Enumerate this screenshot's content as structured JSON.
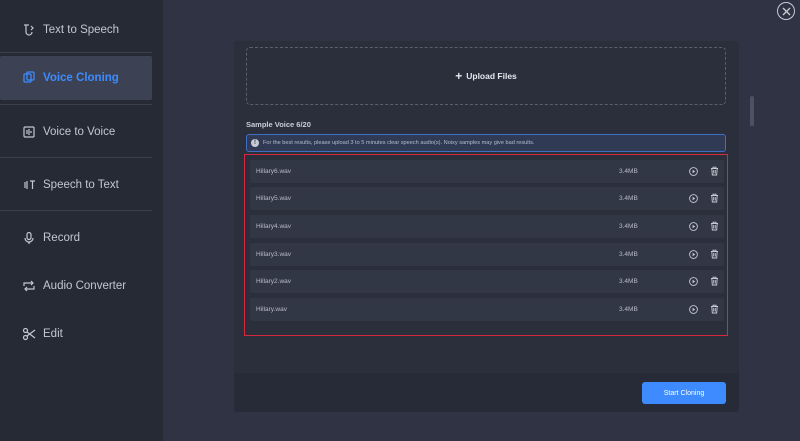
{
  "sidebar": {
    "items": [
      {
        "label": "Text to Speech",
        "icon": "text-to-speech-icon",
        "active": false
      },
      {
        "label": "Voice Cloning",
        "icon": "voice-cloning-icon",
        "active": true
      },
      {
        "label": "Voice to Voice",
        "icon": "voice-to-voice-icon",
        "active": false
      },
      {
        "label": "Speech to Text",
        "icon": "speech-to-text-icon",
        "active": false
      },
      {
        "label": "Record",
        "icon": "microphone-icon",
        "active": false
      },
      {
        "label": "Audio Converter",
        "icon": "convert-icon",
        "active": false
      },
      {
        "label": "Edit",
        "icon": "scissors-icon",
        "active": false
      }
    ]
  },
  "main": {
    "upload_label": "Upload Files",
    "sample_title": "Sample Voice 6/20",
    "hint": "For the best results, please upload 3 to 5 minutes clear speech audio(s). Noisy samples may give bad results.",
    "files": [
      {
        "name": "Hillary6.wav",
        "size": "3.4MB"
      },
      {
        "name": "Hillary5.wav",
        "size": "3.4MB"
      },
      {
        "name": "Hillary4.wav",
        "size": "3.4MB"
      },
      {
        "name": "Hillary3.wav",
        "size": "3.4MB"
      },
      {
        "name": "Hillary2.wav",
        "size": "3.4MB"
      },
      {
        "name": "Hillary.wav",
        "size": "3.4MB"
      }
    ],
    "start_label": "Start Cloning"
  },
  "colors": {
    "accent": "#3d8bff",
    "highlight_border": "#d6283f",
    "sidebar_bg": "#262a35",
    "page_bg": "#2f3344"
  }
}
